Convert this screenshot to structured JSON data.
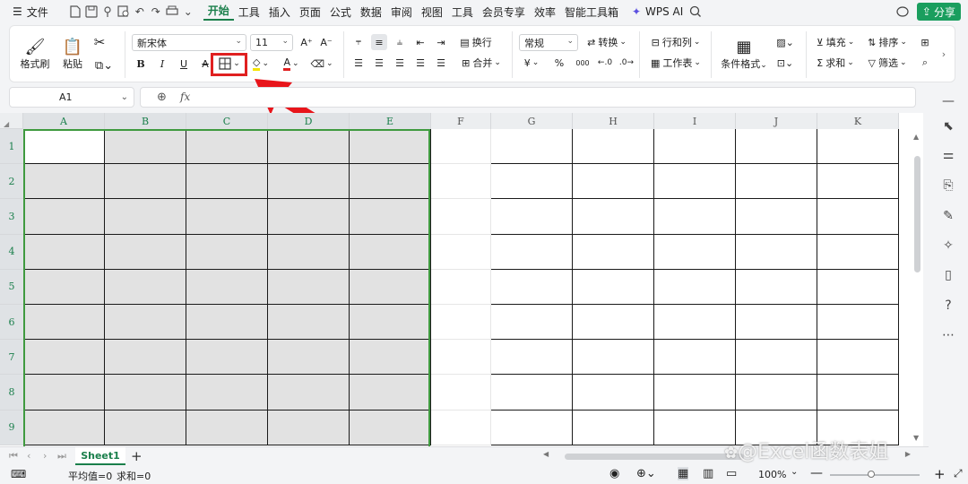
{
  "menubar": {
    "file_label": "文件",
    "tabs": [
      "开始",
      "工具",
      "插入",
      "页面",
      "公式",
      "数据",
      "审阅",
      "视图",
      "工具",
      "会员专享",
      "效率",
      "智能工具箱"
    ],
    "active_tab": "开始",
    "wps_ai_label": "WPS AI",
    "share_label": "分享"
  },
  "ribbon": {
    "format_painter_label": "格式刷",
    "paste_label": "粘贴",
    "font_name": "新宋体",
    "font_size": "11",
    "bold": "B",
    "italic": "I",
    "underline": "U",
    "strike": "A",
    "wrap_label": "换行",
    "merge_label": "合并",
    "number_format": "常规",
    "convert_label": "转换",
    "row_col_label": "行和列",
    "worksheet_label": "工作表",
    "cond_format_label": "条件格式",
    "fill_label": "填充",
    "sort_label": "排序",
    "sum_label": "求和",
    "filter_label": "筛选",
    "currency_symbol": "¥",
    "percent_symbol": "%",
    "thousand_symbol": "000"
  },
  "formula_bar": {
    "cell_ref": "A1",
    "fx_label": "fx",
    "value": ""
  },
  "grid": {
    "columns": [
      "A",
      "B",
      "C",
      "D",
      "E",
      "F",
      "G",
      "H",
      "I",
      "J",
      "K"
    ],
    "rows": [
      "1",
      "2",
      "3",
      "4",
      "5",
      "6",
      "7",
      "8",
      "9"
    ],
    "selected_columns": [
      "A",
      "B",
      "C",
      "D",
      "E"
    ],
    "active_cell": "A1"
  },
  "sheet_tabs": {
    "active": "Sheet1",
    "add_label": "+"
  },
  "status": {
    "average_label": "平均值=0",
    "sum_label": "求和=0",
    "zoom": "100%"
  },
  "watermark": "@Excel函数表姐",
  "colors": {
    "accent": "#1a7f4b",
    "highlight": "#e02020",
    "selection_border": "#3f9a3f",
    "selection_fill": "#e2e2e2"
  }
}
